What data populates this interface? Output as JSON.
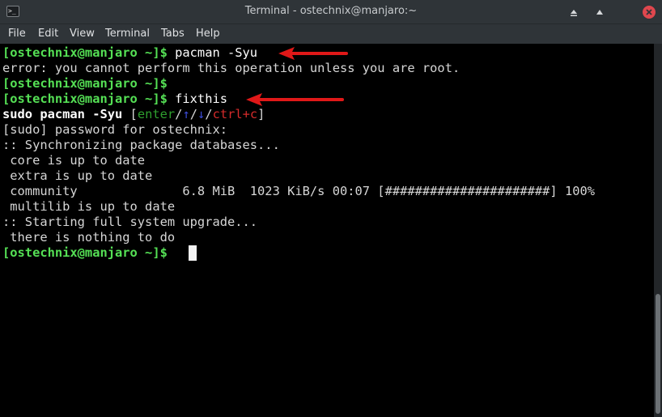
{
  "window": {
    "title": "Terminal - ostechnix@manjaro:~",
    "icon_glyph": ">_"
  },
  "menu": [
    "File",
    "Edit",
    "View",
    "Terminal",
    "Tabs",
    "Help"
  ],
  "terminal": {
    "prompt": "[ostechnix@manjaro ~]$",
    "line1_cmd": " pacman -Syu",
    "line2": "error: you cannot perform this operation unless you are root.",
    "line4_cmd": " fixthis",
    "line5_cmd": "sudo pacman -Syu",
    "hint_open": " [",
    "hint_enter": "enter",
    "hint_slash1": "/",
    "hint_up": "↑",
    "hint_slash2": "/",
    "hint_down": "↓",
    "hint_slash3": "/",
    "hint_ctrlc": "ctrl+c",
    "hint_close": "]",
    "line6": "[sudo] password for ostechnix:",
    "line7": ":: Synchronizing package databases...",
    "line8": " core is up to date",
    "line9": " extra is up to date",
    "line10": " community              6.8 MiB  1023 KiB/s 00:07 [######################] 100%",
    "line11": " multilib is up to date",
    "line12": ":: Starting full system upgrade...",
    "line13": " there is nothing to do"
  },
  "colors": {
    "prompt": "#55e055",
    "annotation_arrow": "#e01818"
  }
}
